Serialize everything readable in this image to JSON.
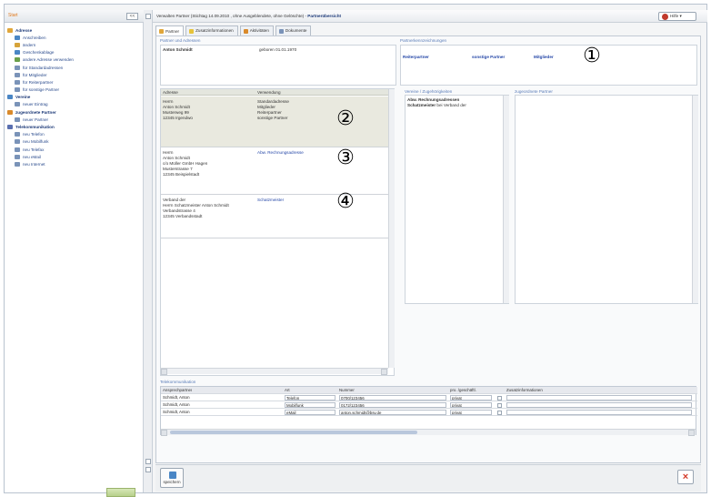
{
  "nav": {
    "header": "Start",
    "collapse_btn": "<<",
    "items": [
      {
        "label": "Adresse",
        "group": true,
        "color": "#e0a63a"
      },
      {
        "label": "Anschreiben",
        "group": false,
        "color": "#4a86c5"
      },
      {
        "label": "ändern",
        "group": false,
        "color": "#d6a33a"
      },
      {
        "label": "Geschenkablage",
        "group": false,
        "color": "#4a86c5"
      },
      {
        "label": "andere Adresse verwenden",
        "group": false,
        "color": "#6aa04b"
      },
      {
        "label": "für Standardadressen",
        "group": false,
        "color": "#7a93b8"
      },
      {
        "label": "für Mitglieder",
        "group": false,
        "color": "#7a93b8"
      },
      {
        "label": "für Reiterpartner",
        "group": false,
        "color": "#7a93b8"
      },
      {
        "label": "für sonstige Partner",
        "group": false,
        "color": "#7a93b8"
      },
      {
        "label": "Vereine",
        "group": true,
        "color": "#4a86c5"
      },
      {
        "label": "neuer Eintrag",
        "group": false,
        "color": "#7a93b8"
      },
      {
        "label": "zugeordnete Partner",
        "group": true,
        "color": "#d98a2b"
      },
      {
        "label": "neuer Partner",
        "group": false,
        "color": "#7a93b8"
      },
      {
        "label": "Telekommunikation",
        "group": true,
        "color": "#5a6fb0"
      },
      {
        "label": "neu Telefon",
        "group": false,
        "color": "#7a93b8"
      },
      {
        "label": "neu Mobilfunk",
        "group": false,
        "color": "#7a93b8"
      },
      {
        "label": "neu Telefax",
        "group": false,
        "color": "#7a93b8"
      },
      {
        "label": "neu eMail",
        "group": false,
        "color": "#7a93b8"
      },
      {
        "label": "neu Internet",
        "group": false,
        "color": "#7a93b8"
      }
    ]
  },
  "titlebar": {
    "prefix": "Verwalten Partner (Stichtag 14.09.2010 , ohne Ausgeblendete, ohne Gelöschte) - ",
    "title": "Partnerübersicht",
    "help": "Hilfe"
  },
  "tabs": [
    {
      "label": "Partner",
      "color": "#e0a63a",
      "active": true
    },
    {
      "label": "Zusatzinformationen",
      "color": "#e6c33a",
      "active": false
    },
    {
      "label": "Aktivitäten",
      "color": "#d98a2b",
      "active": false
    },
    {
      "label": "Dokumente",
      "color": "#7a93b8",
      "active": false
    }
  ],
  "partner": {
    "section": "Partner und Adressen",
    "name": "Anton Schmidt",
    "born": "geboren 01.01.1970"
  },
  "kennz": {
    "section": "Partnerkennzeichnungen",
    "links": [
      "Reiterpartner",
      "sonstige Partner",
      "Mitglieder"
    ]
  },
  "addresses": {
    "col_addr": "Adresse",
    "col_use": "Verwendung",
    "blocks": [
      {
        "addr": "Herrn\nAnton Schmidt\nMusterweg 99\n12345 Irgendwo",
        "use": "Standardadresse\nMitglieder\nReiterpartner\nsonstige Partner",
        "link": false
      },
      {
        "addr": "Herrn\nAnton Schmidt\nc/o Müller GmbH Hagen\nMusterstrasse 7\n12345 Beispielstadt",
        "use": "Abw. Rechnungsadresse",
        "link": true
      },
      {
        "addr": "Verband der\nHerrn Schatzmeister Anton Schmidt\nVerbandstrasse 4\n12345 Verbandsstadt",
        "use": "Schatzmeister",
        "link": true
      }
    ]
  },
  "vereine": {
    "section": "Vereine / Zugehörigkeiten",
    "line1": "Abw. Rechnungsadressen",
    "line2_bold": "Schatzmeister",
    "line2_rest": " bei Verband der"
  },
  "zugeordnete": {
    "section": "zugeordnete Partner"
  },
  "telekom": {
    "section": "Telekommunikation",
    "headers": [
      "Ansprechpartner",
      "Art",
      "Nummer",
      "pro. /geschäftl.",
      "Zusatzinformationen"
    ],
    "rows": [
      {
        "name": "Schmidt, Anton",
        "art": "Telefon",
        "nr": "0700/123456",
        "typ": "privat"
      },
      {
        "name": "Schmidt, Anton",
        "art": "Mobilfunk",
        "nr": "0172/123456",
        "typ": "privat"
      },
      {
        "name": "Schmidt, Anton",
        "art": "eMail",
        "nr": "anton.schmidt@bsv.de",
        "typ": "privat"
      }
    ]
  },
  "footer": {
    "save": "speichern",
    "close": "×"
  },
  "markers": [
    "①",
    "②",
    "③",
    "④"
  ]
}
